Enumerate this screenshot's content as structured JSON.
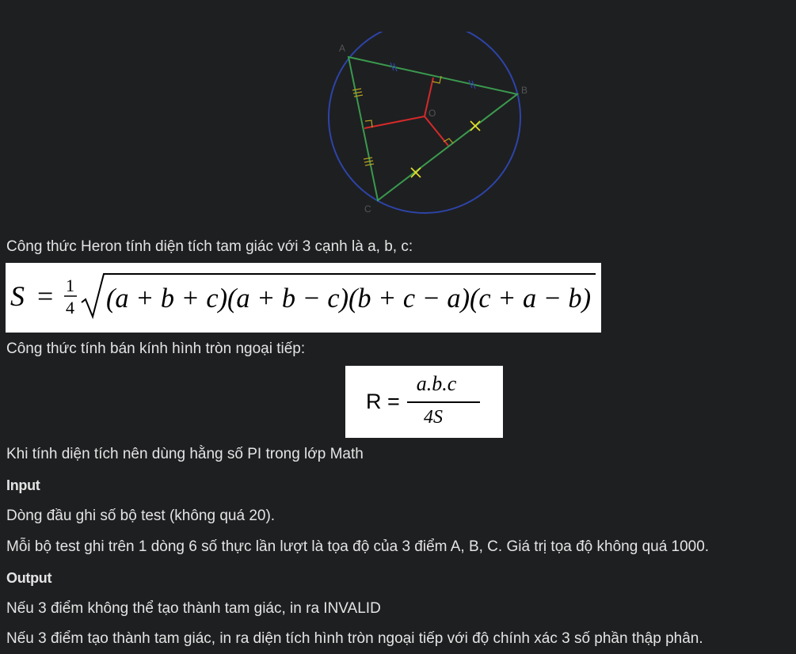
{
  "figure": {
    "vertex_labels": {
      "a": "A",
      "b": "B",
      "c": "C",
      "o": "O"
    },
    "colors": {
      "circle": "#2d44a8",
      "triangle": "#3a9a4e",
      "bisectors": "#d42a2a",
      "marks_ab": "#2d44a8",
      "marks_ac": "#b8a022",
      "marks_bc": "#e8e02a",
      "labels": "#555555"
    }
  },
  "intro_text": "Công thức Heron tính diện tích tam giác với 3 cạnh là a, b, c:",
  "heron_formula": {
    "lhs": "S",
    "eq": "=",
    "frac_num": "1",
    "frac_den": "4",
    "radicand": "(a + b + c)(a + b − c)(b + c − a)(c + a − b)"
  },
  "radius_intro": "Công thức tính bán kính hình tròn ngoại tiếp:",
  "radius_formula": {
    "lhs": "R =",
    "numerator": "a.b.c",
    "denominator": "4S"
  },
  "pi_note": "Khi tính diện tích nên dùng hằng số PI trong lớp Math",
  "input": {
    "heading": "Input",
    "line1": "Dòng đầu ghi số bộ test (không quá 20).",
    "line2": "Mỗi bộ test ghi trên 1 dòng 6 số thực lần lượt là tọa độ của 3 điểm A, B, C. Giá trị tọa độ không quá 1000."
  },
  "output": {
    "heading": "Output",
    "line1": "Nếu 3 điểm không thể tạo thành tam giác, in ra INVALID",
    "line2": "Nếu 3 điểm tạo thành tam giác, in ra diện tích hình tròn ngoại tiếp với độ chính xác 3 số phần thập phân."
  }
}
